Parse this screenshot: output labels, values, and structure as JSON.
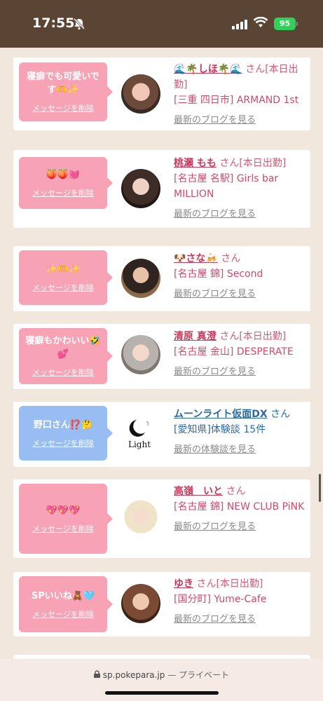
{
  "status": {
    "time": "17:55",
    "battery": "95"
  },
  "cards": [
    {
      "message": "寝癖でも可愛いです🫶✨",
      "delete_label": "メッセージを削除",
      "name": "🌊🌴しほ🌴🌊",
      "san": "さん",
      "status": "[本日出勤]",
      "shop": "[三重 四日市] ARMAND 1st",
      "link": "最新のブログを見る"
    },
    {
      "message": "🍑🍑💓",
      "delete_label": "メッセージを削除",
      "name": "桃瀬 もも",
      "san": "さん",
      "status": "[本日出勤]",
      "shop": "[名古屋 名駅] Girls bar MILLION",
      "link": "最新のブログを見る"
    },
    {
      "message": "✨🫶✨",
      "delete_label": "メッセージを削除",
      "name": "🐶さな🍻",
      "san": "さん",
      "status": "",
      "shop": "[名古屋 錦] Second",
      "link": "最新のブログを見る"
    },
    {
      "message": "寝癖もかわいい🤣💕",
      "delete_label": "メッセージを削除",
      "name": "清原 真澄",
      "san": "さん",
      "status": "[本日出勤]",
      "shop": "[名古屋 金山] DESPERATE",
      "link": "最新のブログを見る"
    },
    {
      "message": "野口さん⁉️🤔",
      "delete_label": "メッセージを削除",
      "name": "ムーンライト仮面DX",
      "san": "さん",
      "status": "",
      "shop": "[愛知県]体験談 15件",
      "link": "最新の体験談を見る",
      "logo_text": "Light"
    },
    {
      "message": "💖💖💖",
      "delete_label": "メッセージを削除",
      "name": "高嶺　いと",
      "san": "さん",
      "status": "",
      "shop": "[名古屋 錦] NEW CLUB PiNK",
      "link": "最新のブログを見る"
    },
    {
      "message": "SPいいね🧸🩵",
      "delete_label": "メッセージを削除",
      "name": "ゆき",
      "san": "さん",
      "status": "[本日出勤]",
      "shop": "[国分町] Yume-Cafe",
      "link": "最新のブログを見る"
    }
  ],
  "url_bar": {
    "domain": "sp.pokepara.jp",
    "mode": "— プライベート"
  },
  "colors": {
    "pink_bubble": "#f7a2b5",
    "blue_bubble": "#97bdf3",
    "name_pink": "#c7395a",
    "name_blue": "#2a6aa5"
  }
}
